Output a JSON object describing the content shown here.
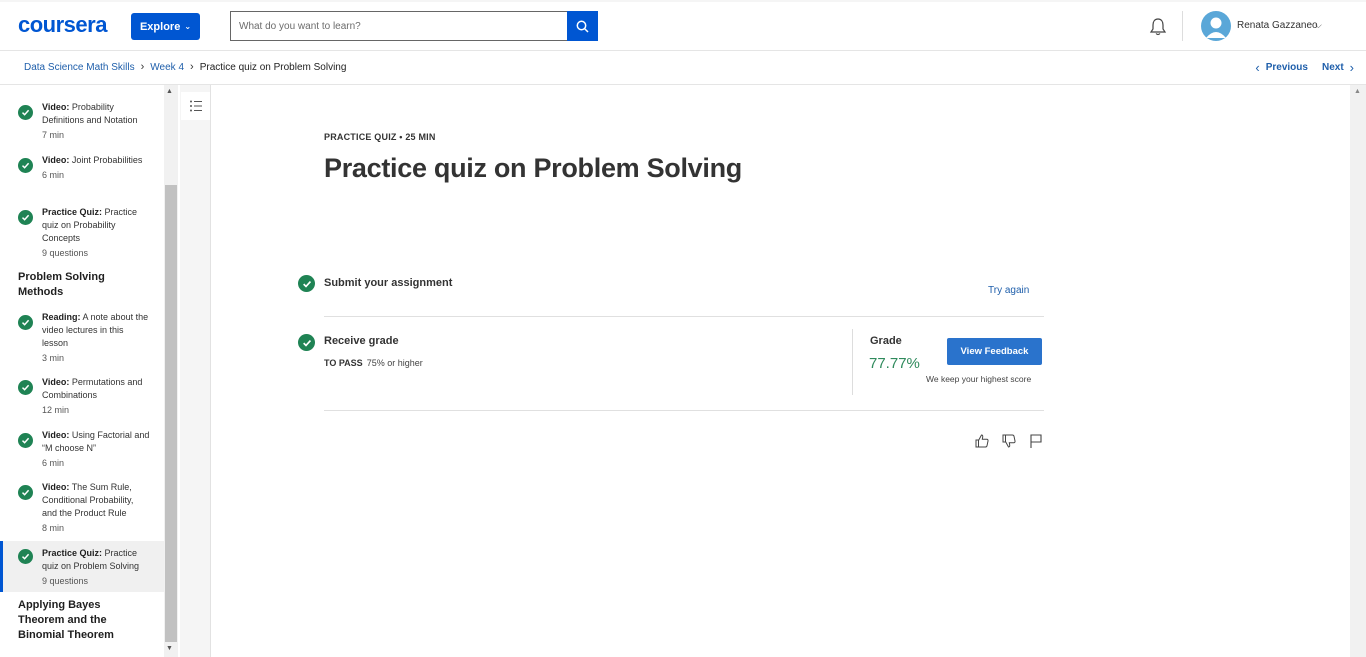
{
  "header": {
    "logo": "coursera",
    "explore_label": "Explore",
    "search_placeholder": "What do you want to learn?",
    "user_name": "Renata Gazzaneo"
  },
  "breadcrumb": {
    "items": [
      "Data Science Math Skills",
      "Week 4",
      "Practice quiz on Problem Solving"
    ],
    "previous": "Previous",
    "next": "Next"
  },
  "sidebar": {
    "items": [
      {
        "type": "Video:",
        "title": "Probability Definitions and Notation",
        "meta": "7 min"
      },
      {
        "type": "Video:",
        "title": "Joint Probabilities",
        "meta": "6 min"
      },
      {
        "type": "Practice Quiz:",
        "title": "Practice quiz on Probability Concepts",
        "meta": "9 questions"
      },
      {
        "type": "Reading:",
        "title": "A note about the video lectures in this lesson",
        "meta": "3 min"
      },
      {
        "type": "Video:",
        "title": "Permutations and Combinations",
        "meta": "12 min"
      },
      {
        "type": "Video:",
        "title": "Using Factorial and “M choose N”",
        "meta": "6 min"
      },
      {
        "type": "Video:",
        "title": "The Sum Rule, Conditional Probability, and the Product Rule",
        "meta": "8 min"
      },
      {
        "type": "Practice Quiz:",
        "title": "Practice quiz on Problem Solving",
        "meta": "9 questions"
      }
    ],
    "sections": [
      "Problem Solving Methods",
      "Applying Bayes Theorem and the Binomial Theorem"
    ]
  },
  "main": {
    "kicker": "PRACTICE QUIZ • 25 MIN",
    "title": "Practice quiz on Problem Solving",
    "submit_label": "Submit your assignment",
    "try_again": "Try again",
    "receive_grade": "Receive grade",
    "to_pass_label": "TO PASS",
    "to_pass_value": "75% or higher",
    "grade_head": "Grade",
    "grade_value": "77.77%",
    "feedback_button": "View Feedback",
    "keep_score": "We keep your highest score"
  },
  "colors": {
    "brand": "#0056d2",
    "success": "#1f8354",
    "link": "#1f5fab"
  }
}
